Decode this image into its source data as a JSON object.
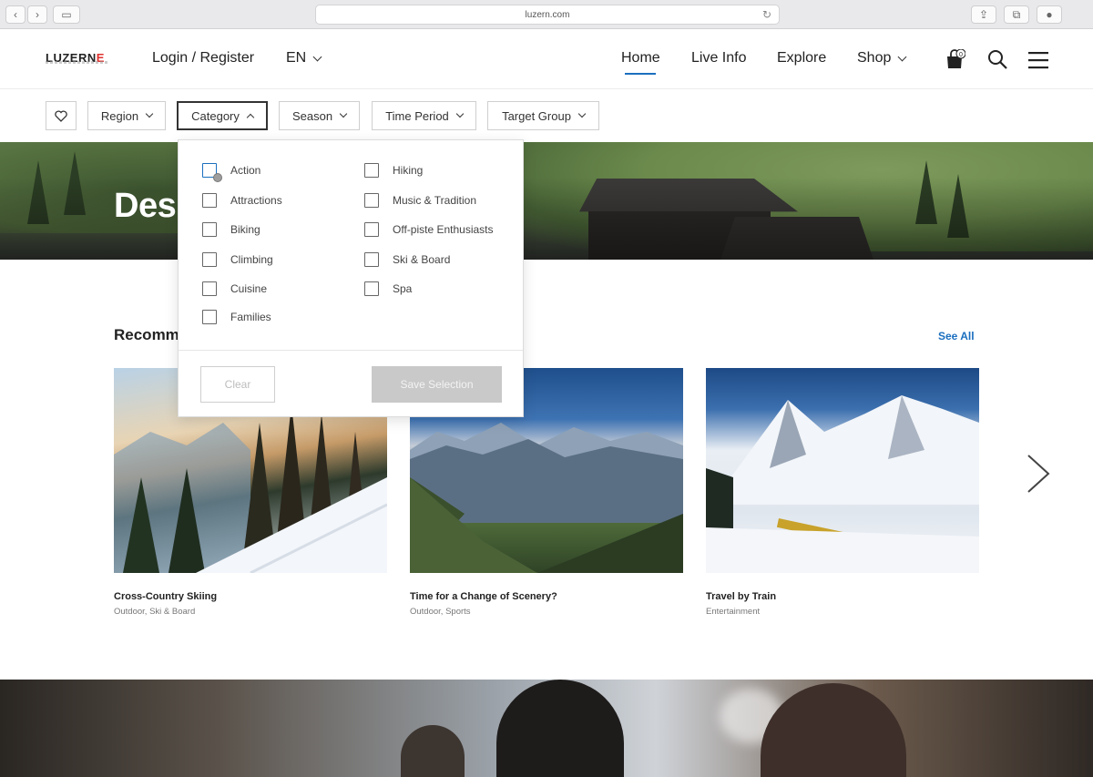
{
  "browser": {
    "url": "luzern.com",
    "back_icon": "chevron-left-icon",
    "forward_icon": "chevron-right-icon",
    "sidebar_icon": "sidebar-icon",
    "reload_icon": "reload-icon",
    "share_icon": "share-icon",
    "tabs_icon": "tabs-icon",
    "extension_icon": "extension-icon"
  },
  "header": {
    "logo_main": "LUZERN",
    "logo_accent": "E",
    "login": "Login / Register",
    "language": "EN",
    "nav": [
      {
        "label": "Home",
        "active": true
      },
      {
        "label": "Live Info"
      },
      {
        "label": "Explore"
      },
      {
        "label": "Shop",
        "has_dropdown": true
      }
    ],
    "cart_count": "0",
    "accent_color": "#1b6fbf"
  },
  "filters": {
    "items": [
      {
        "label": "Region"
      },
      {
        "label": "Category",
        "open": true
      },
      {
        "label": "Season"
      },
      {
        "label": "Time Period"
      },
      {
        "label": "Target Group"
      }
    ]
  },
  "category_dropdown": {
    "left_options": [
      "Action",
      "Attractions",
      "Biking",
      "Climbing",
      "Cuisine",
      "Families"
    ],
    "right_options": [
      "Hiking",
      "Music & Tradition",
      "Off-piste Enthusiasts",
      "Ski & Board",
      "Spa"
    ],
    "clear_label": "Clear",
    "save_label": "Save Selection"
  },
  "hero": {
    "title": "Des"
  },
  "recommended": {
    "title": "Recomm",
    "see_all": "See All",
    "cards": [
      {
        "title": "Cross-Country Skiing",
        "tags": "Outdoor, Ski & Board"
      },
      {
        "title": "Time for a Change of Scenery?",
        "tags": "Outdoor, Sports"
      },
      {
        "title": "Travel by Train",
        "tags": "Entertainment"
      }
    ]
  }
}
